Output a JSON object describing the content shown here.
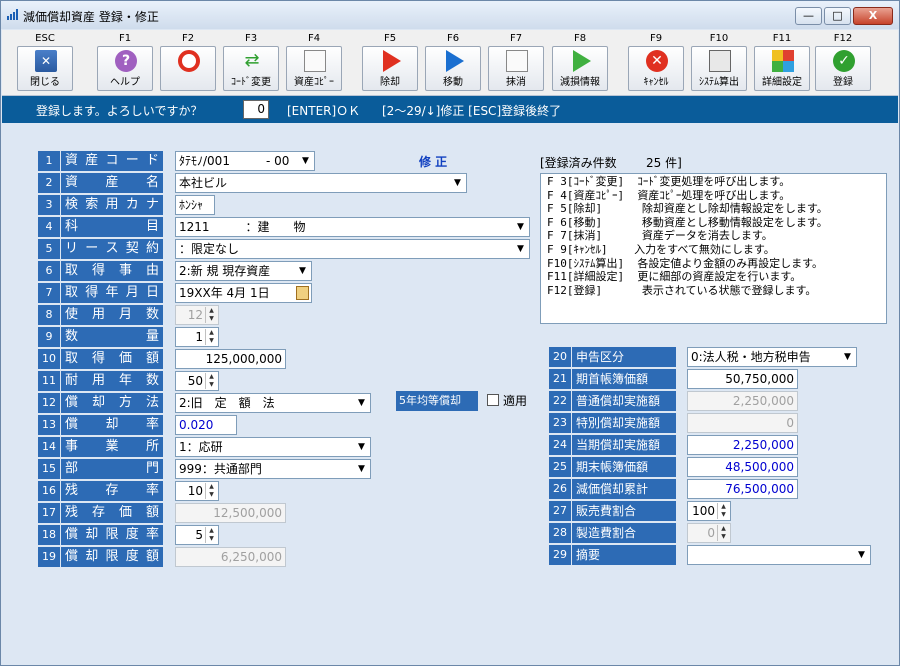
{
  "window": {
    "title": "減価償却資産 登録・修正",
    "minimize": "—",
    "maximize": "□",
    "close": "X"
  },
  "toolbar": [
    {
      "key": "ESC",
      "label": "閉じる",
      "icon": "exit-monitor-icon"
    },
    {
      "key": "F1",
      "label": "ヘルプ",
      "icon": "help-icon"
    },
    {
      "key": "F2",
      "label": "",
      "icon": "prohibit-icon"
    },
    {
      "key": "F3",
      "label": "ｺｰﾄﾞ変更",
      "icon": "shuffle-icon"
    },
    {
      "key": "F4",
      "label": "資産ｺﾋﾟｰ",
      "icon": "copy-icon"
    },
    {
      "key": "F5",
      "label": "除却",
      "icon": "play-red-icon"
    },
    {
      "key": "F6",
      "label": "移動",
      "icon": "play-blue-icon"
    },
    {
      "key": "F7",
      "label": "抹消",
      "icon": "delete-doc-icon"
    },
    {
      "key": "F8",
      "label": "減損情報",
      "icon": "play-green-icon"
    },
    {
      "key": "F9",
      "label": "ｷｬﾝｾﾙ",
      "icon": "cancel-icon"
    },
    {
      "key": "F10",
      "label": "ｼｽﾃﾑ算出",
      "icon": "calculator-icon"
    },
    {
      "key": "F11",
      "label": "詳細設定",
      "icon": "settings-icon"
    },
    {
      "key": "F12",
      "label": "登録",
      "icon": "check-icon"
    }
  ],
  "prompt": {
    "question": "登録します。よろしいですか？",
    "answer": "0",
    "ok": "[ENTER]ＯＫ",
    "help": "[2～29/↓]修正 [ESC]登録後終了"
  },
  "mode": "修 正",
  "left": [
    {
      "n": "1",
      "label": "資産コード",
      "value": "ﾀﾃﾓﾉ/001　　　- 00"
    },
    {
      "n": "2",
      "label": "資産名",
      "value": "本社ビル"
    },
    {
      "n": "3",
      "label": "検索用カナ",
      "value": "ﾎﾝｼｬ"
    },
    {
      "n": "4",
      "label": "科目",
      "value": "1211　　　：建　　物"
    },
    {
      "n": "5",
      "label": "リース契約",
      "value": "：限定なし"
    },
    {
      "n": "6",
      "label": "取得事由",
      "value": "2:新 規 現存資産"
    },
    {
      "n": "7",
      "label": "取得年月日",
      "value": "19XX年 4月 1日"
    },
    {
      "n": "8",
      "label": "使用月数",
      "value": "12"
    },
    {
      "n": "9",
      "label": "数量",
      "value": "1"
    },
    {
      "n": "10",
      "label": "取得価額",
      "value": "125,000,000"
    },
    {
      "n": "11",
      "label": "耐用年数",
      "value": "50"
    },
    {
      "n": "12",
      "label": "償却方法",
      "value": "2:旧　定　額　法"
    },
    {
      "n": "13",
      "label": "償却率",
      "value": "0.020"
    },
    {
      "n": "14",
      "label": "事業所",
      "value": "1：応研"
    },
    {
      "n": "15",
      "label": "部門",
      "value": "999：共通部門"
    },
    {
      "n": "16",
      "label": "残存率",
      "value": "10"
    },
    {
      "n": "17",
      "label": "残存価額",
      "value": "12,500,000"
    },
    {
      "n": "18",
      "label": "償却限度率",
      "value": "5"
    },
    {
      "n": "19",
      "label": "償却限度額",
      "value": "6,250,000"
    }
  ],
  "five_year": {
    "label": "5年均等償却",
    "checkbox": "適用"
  },
  "registered": {
    "label": "[登録済み件数",
    "count": "25 件]"
  },
  "help_text": "F 3[ｺｰﾄﾞ変更]  ｺｰﾄﾞ変更処理を呼び出します。\nF 4[資産ｺﾋﾟｰ]  資産ｺﾋﾟｰ処理を呼び出します。\nF 5[除却]      除却資産とし除却情報設定をします。\nF 6[移動]      移動資産とし移動情報設定をします。\nF 7[抹消]      資産データを消去します。\nF 9[ｷｬﾝｾﾙ]    入力をすべて無効にします。\nF10[ｼｽﾃﾑ算出]  各設定値より金額のみ再設定します。\nF11[詳細設定]  更に細部の資産設定を行います。\nF12[登録]      表示されている状態で登録します。",
  "right": [
    {
      "n": "20",
      "label": "申告区分",
      "value": "0:法人税・地方税申告"
    },
    {
      "n": "21",
      "label": "期首帳簿価額",
      "value": "50,750,000"
    },
    {
      "n": "22",
      "label": "普通償却実施額",
      "value": "2,250,000"
    },
    {
      "n": "23",
      "label": "特別償却実施額",
      "value": "0"
    },
    {
      "n": "24",
      "label": "当期償却実施額",
      "value": "2,250,000"
    },
    {
      "n": "25",
      "label": "期末帳簿価額",
      "value": "48,500,000"
    },
    {
      "n": "26",
      "label": "減価償却累計",
      "value": "76,500,000"
    },
    {
      "n": "27",
      "label": "販売費割合",
      "value": "100"
    },
    {
      "n": "28",
      "label": "製造費割合",
      "value": "0"
    },
    {
      "n": "29",
      "label": "摘要",
      "value": ""
    }
  ]
}
